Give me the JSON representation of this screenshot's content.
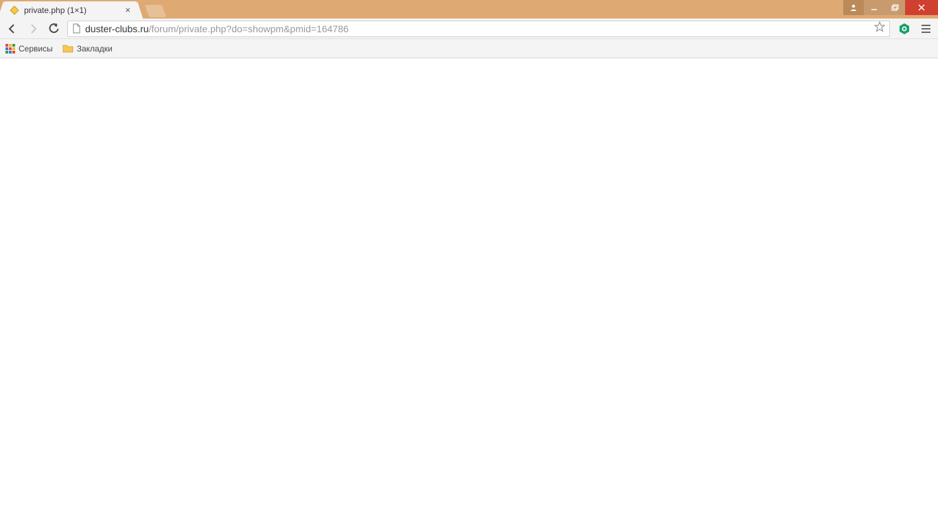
{
  "tab": {
    "title": "private.php (1×1)",
    "favicon": "diamond-yellow"
  },
  "url": {
    "domain": "duster-clubs.ru",
    "path": "/forum/private.php?do=showpm&pmid=164786"
  },
  "bookmarks": {
    "apps_label": "Сервисы",
    "folder_label": "Закладки"
  },
  "icons": {
    "close_tab": "×",
    "minimize": "—",
    "maximize": "❐",
    "close_window": "✕",
    "user": "▪"
  }
}
